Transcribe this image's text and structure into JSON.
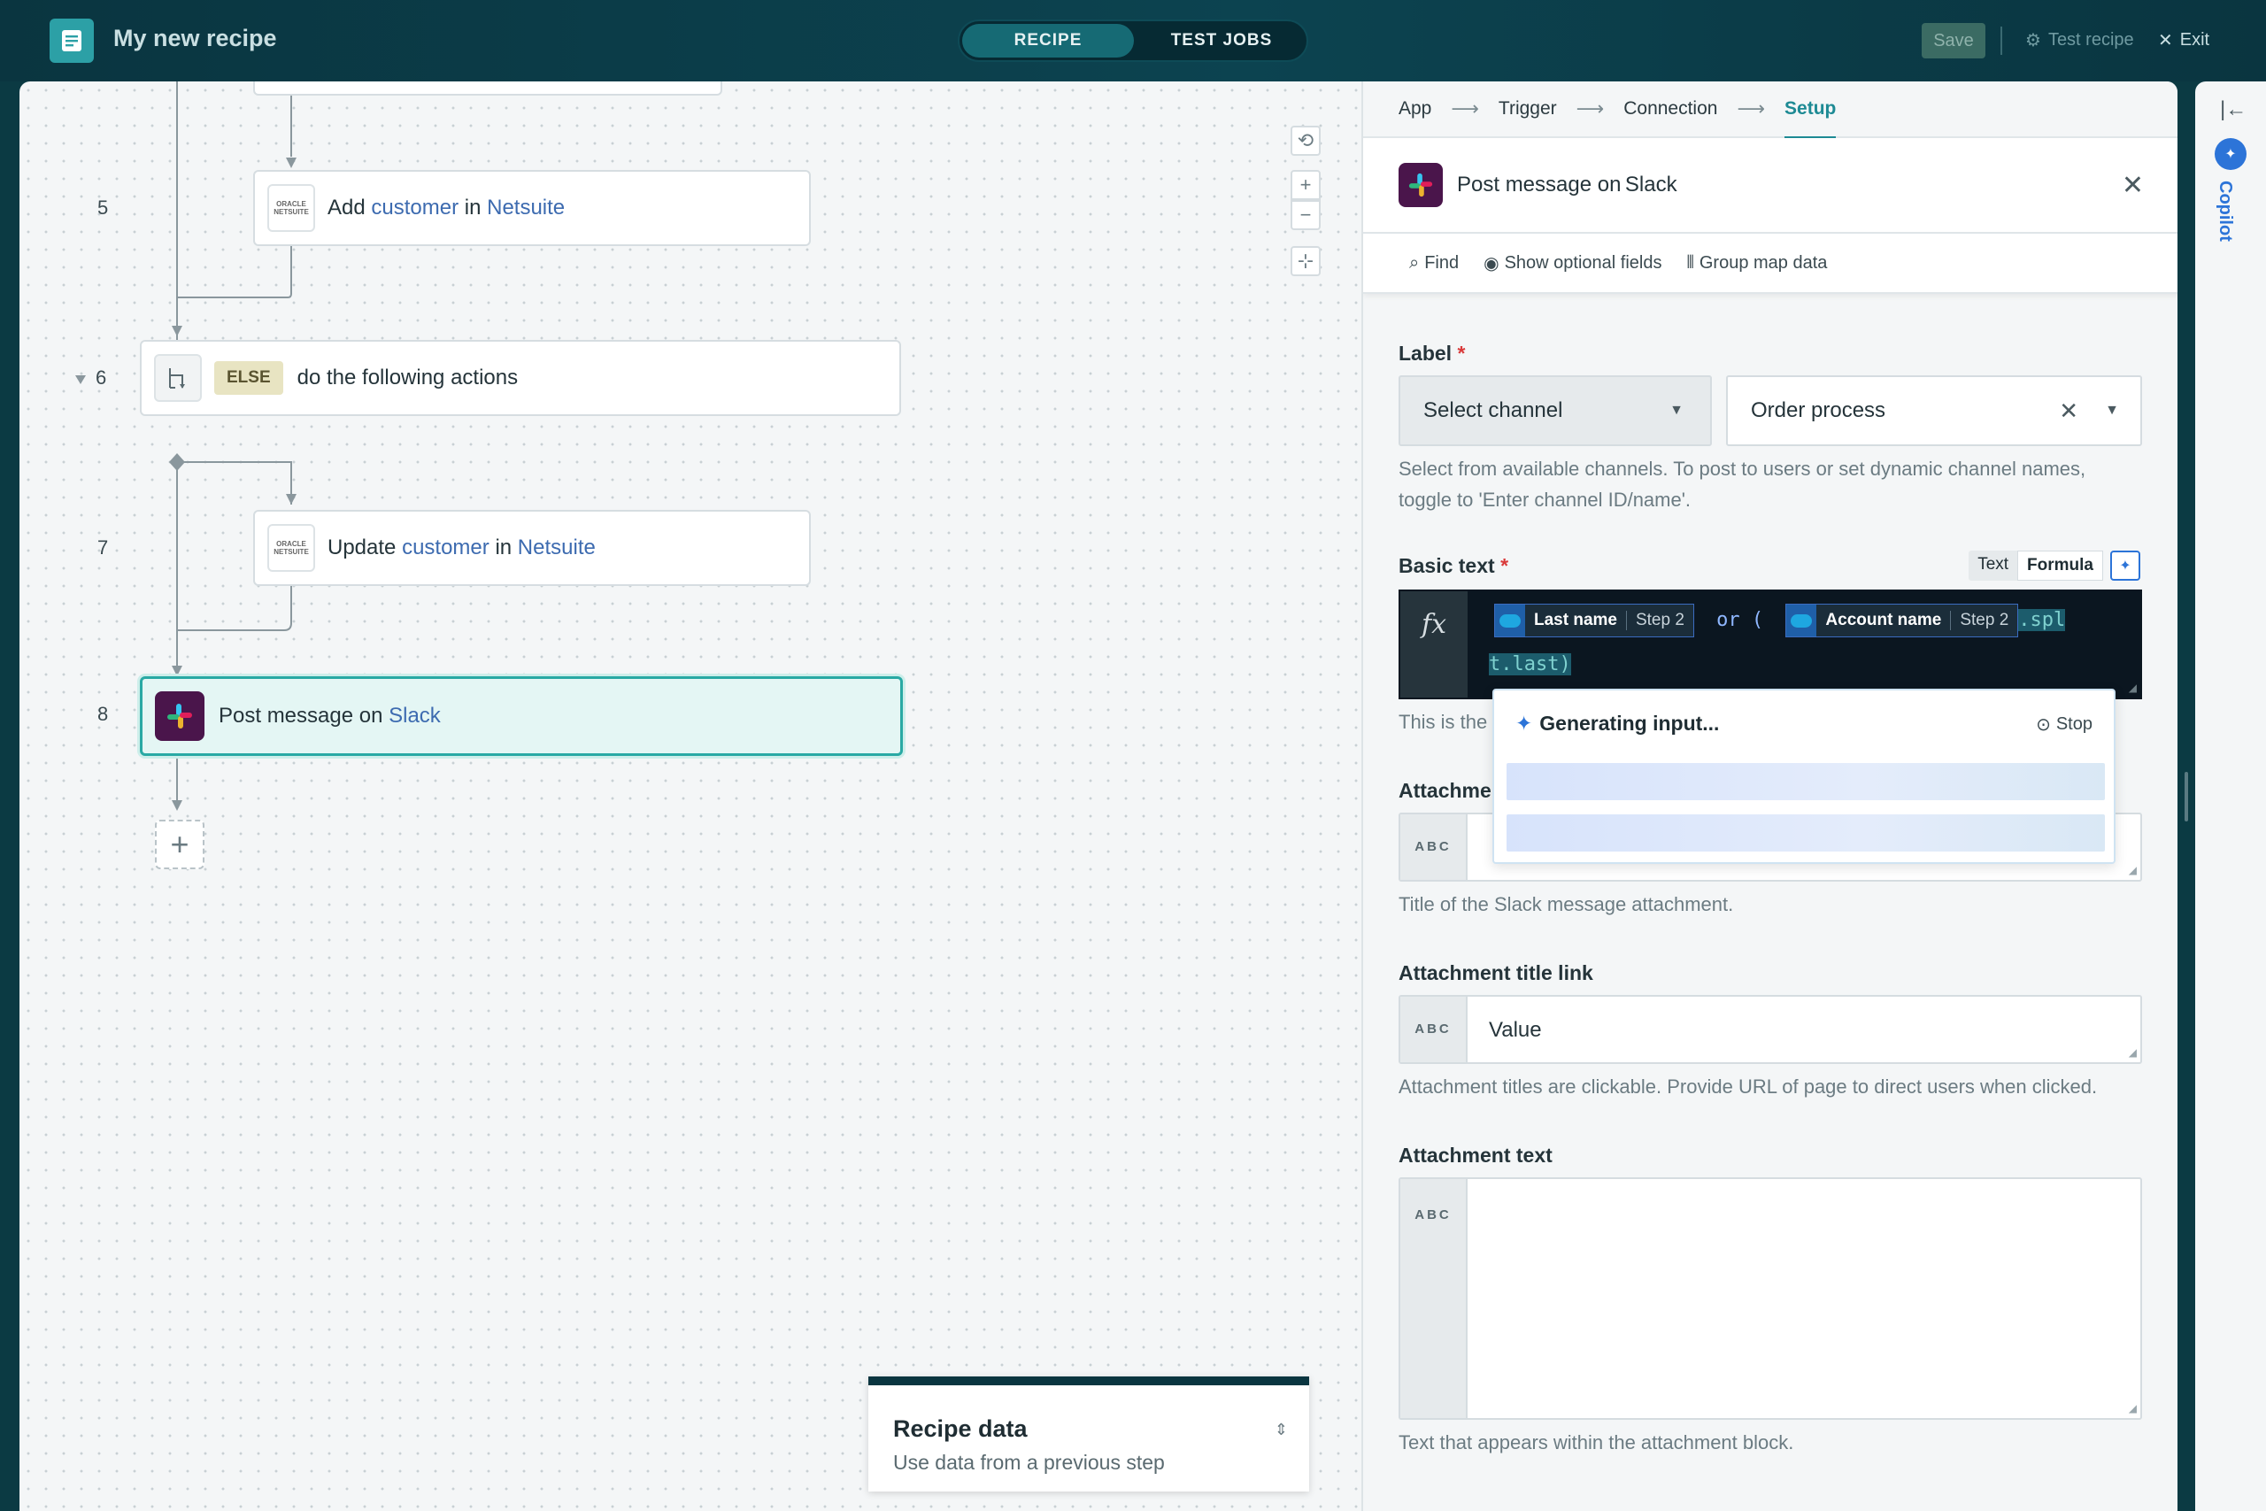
{
  "header": {
    "title": "My new recipe",
    "tabs": [
      {
        "label": "RECIPE",
        "active": true
      },
      {
        "label": "TEST JOBS",
        "active": false
      }
    ],
    "save_label": "Save",
    "test_recipe_label": "Test recipe",
    "exit_label": "Exit"
  },
  "canvas": {
    "steps": [
      {
        "num": "5",
        "prefix": "Add",
        "object": "customer",
        "connector": "in",
        "app": "Netsuite"
      },
      {
        "num": "6",
        "badge": "ELSE",
        "text": "do the following actions"
      },
      {
        "num": "7",
        "prefix": "Update",
        "object": "customer",
        "connector": "in",
        "app": "Netsuite"
      },
      {
        "num": "8",
        "prefix": "Post message on",
        "app": "Slack"
      }
    ],
    "oracle_logo": "ORACLE NETSUITE",
    "add_step": "+",
    "zoom": {
      "reset": "⟲",
      "in": "+",
      "out": "−",
      "fit": "⊹"
    },
    "recipe_data": {
      "title": "Recipe data",
      "subtitle": "Use data from a previous step"
    }
  },
  "panel": {
    "breadcrumbs": [
      "App",
      "Trigger",
      "Connection",
      "Setup"
    ],
    "breadcrumb_arrow": "⟶",
    "active_breadcrumb": "Setup",
    "title_prefix": "Post message on",
    "title_app": "Slack",
    "close": "✕",
    "toolbar": {
      "find": "Find",
      "optional": "Show optional fields",
      "group": "Group map data"
    },
    "label_field": {
      "label": "Label",
      "select_value": "Select channel",
      "channel_value": "Order process",
      "hint_line1": "Select from available channels. To post to users or set dynamic channel names,",
      "hint_line2": "toggle to 'Enter channel ID/name'."
    },
    "basic_text": {
      "label": "Basic text",
      "mode_text": "Text",
      "mode_formula": "Formula",
      "fx": "fx",
      "pills": [
        {
          "name": "Last name",
          "step": "Step 2"
        },
        {
          "name": "Account name",
          "step": "Step 2"
        }
      ],
      "operator": "or (",
      "code_tail_1": ".spl",
      "code_tail_2": "t.last)",
      "hint": "This is the"
    },
    "generating": {
      "title": "Generating input...",
      "stop": "Stop"
    },
    "attachment_title": {
      "label": "Attachmen",
      "hint": "Title of the Slack message attachment."
    },
    "attachment_link": {
      "label": "Attachment title link",
      "value": "Value",
      "hint": "Attachment titles are clickable. Provide URL of page to direct users when clicked."
    },
    "attachment_text": {
      "label": "Attachment text",
      "hint": "Text that appears within the attachment block."
    },
    "abc": "ABC"
  },
  "sidebar": {
    "copilot": "Copilot",
    "collapse": "|←"
  }
}
